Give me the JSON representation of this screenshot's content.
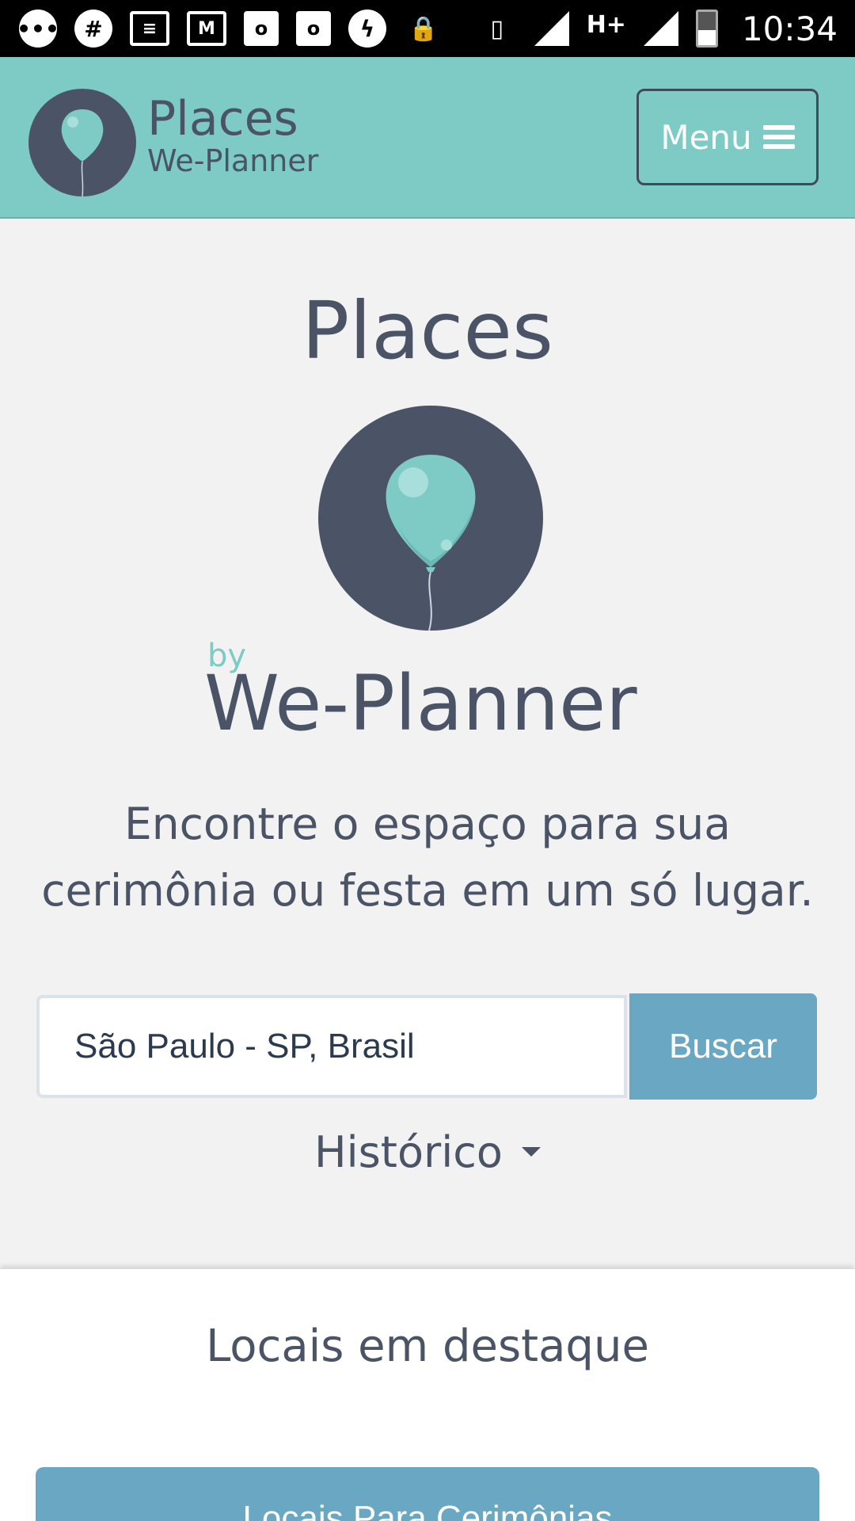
{
  "status_bar": {
    "time": "10:34",
    "network": "H+",
    "icons": [
      "chat-bubble-icon",
      "slack-icon",
      "news-icon",
      "gmail-icon",
      "outlook-icon",
      "outlook-icon",
      "messenger-icon",
      "lock-icon",
      "vibrate-icon",
      "signal-icon",
      "signal-icon",
      "battery-icon"
    ]
  },
  "header": {
    "title": "Places",
    "subtitle": "We-Planner",
    "menu_label": "Menu"
  },
  "hero": {
    "title": "Places",
    "by": "by",
    "brand": "We-Planner",
    "tagline_line1": "Encontre o espaço para sua",
    "tagline_line2": "cerimônia ou festa em um só lugar."
  },
  "search": {
    "value": "São Paulo - SP, Brasil",
    "button_label": "Buscar"
  },
  "history": {
    "label": "Histórico"
  },
  "featured": {
    "title": "Locais em destaque",
    "category_label": "Locais Para Cerimônias"
  },
  "colors": {
    "header_bg": "#7ecbc5",
    "accent_button": "#6aa7c2",
    "text_dark": "#4a5466",
    "balloon": "#7ecbc5"
  }
}
